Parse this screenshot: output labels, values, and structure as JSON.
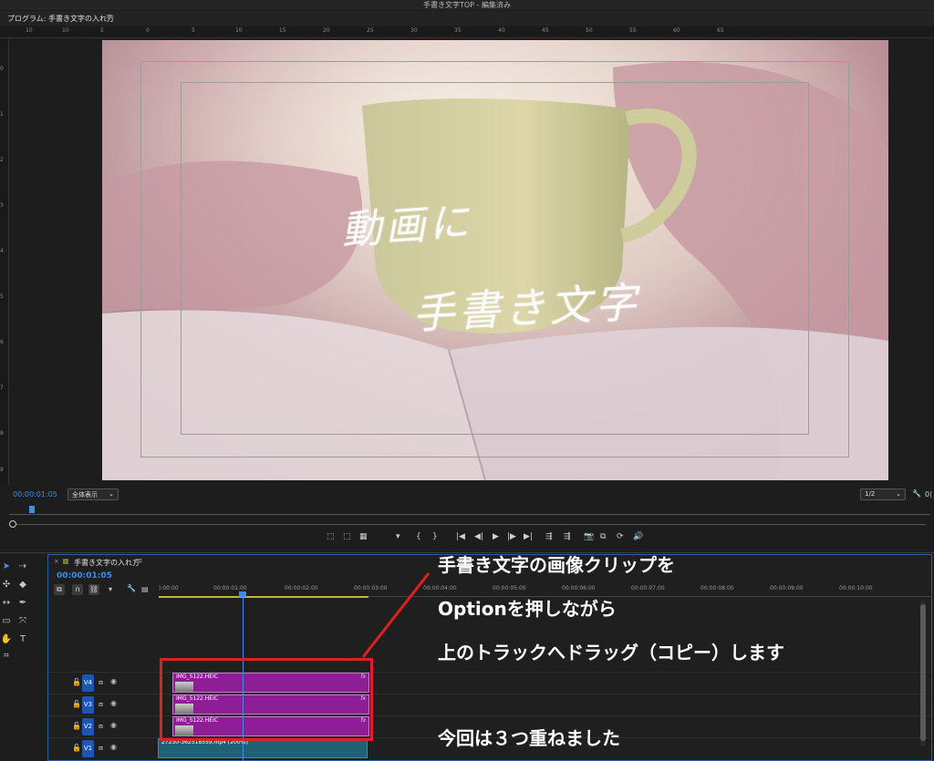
{
  "window": {
    "title": "手書き文字TOP - 編集済み"
  },
  "program_monitor": {
    "panel_title": "プログラム: 手書き文字の入れ方",
    "menu_glyph": "≡",
    "ruler_labels": [
      "10",
      "10",
      "5",
      "0",
      "5",
      "10",
      "15",
      "20",
      "25",
      "30",
      "35",
      "40",
      "45",
      "50",
      "55",
      "60",
      "65"
    ],
    "vruler_labels": [
      "0",
      "1",
      "2",
      "3",
      "4",
      "5",
      "6",
      "7",
      "8",
      "9"
    ],
    "overlay_text_line1": "動画に",
    "overlay_text_line2": "手書き文字",
    "timecode": "00:00:01:05",
    "zoom_select": "全体表示",
    "resolution_select": "1/2",
    "right_timecode_fragment": "0("
  },
  "transport": {
    "buttons": [
      "⬚",
      "⬚",
      "▦",
      "▾",
      "{",
      "}",
      "|◀",
      "◀|",
      "▶",
      "|▶",
      "▶|",
      "⇶",
      "⇶",
      "📷",
      "⧉",
      "⟳",
      "🔊"
    ]
  },
  "timeline": {
    "panel_title": "手書き文字の入れ方",
    "menu_glyph": "≡",
    "timecode": "00:00:01:05",
    "ruler": [
      "):00:00",
      "00:00:01:00",
      "00:00:02:00",
      "00:00:03:00",
      "00:00:04:00",
      "00:00:05:00",
      "00:00:06:00",
      "00:00:07:00",
      "00:00:08:00",
      "00:00:09:00",
      "00:00:10:00"
    ],
    "tracks": [
      {
        "name": "V4",
        "clip": "IMG_5122.HEIC",
        "fx": "fx"
      },
      {
        "name": "V3",
        "clip": "IMG_5122.HEIC",
        "fx": "fx"
      },
      {
        "name": "V2",
        "clip": "IMG_5122.HEIC",
        "fx": "fx"
      },
      {
        "name": "V1",
        "clip": "27230-362518559.mp4 [200%]"
      }
    ]
  },
  "annotation": {
    "line1": "手書き文字の画像クリップを",
    "line2": "Optionを押しながら",
    "line3": "上のトラックへドラッグ（コピー）します",
    "line4": "今回は３つ重ねました"
  },
  "colors": {
    "accent_blue": "#3d8ee8",
    "clip_purple": "#8e1e95",
    "clip_teal": "#1f6276",
    "highlight_red": "#e02020"
  }
}
